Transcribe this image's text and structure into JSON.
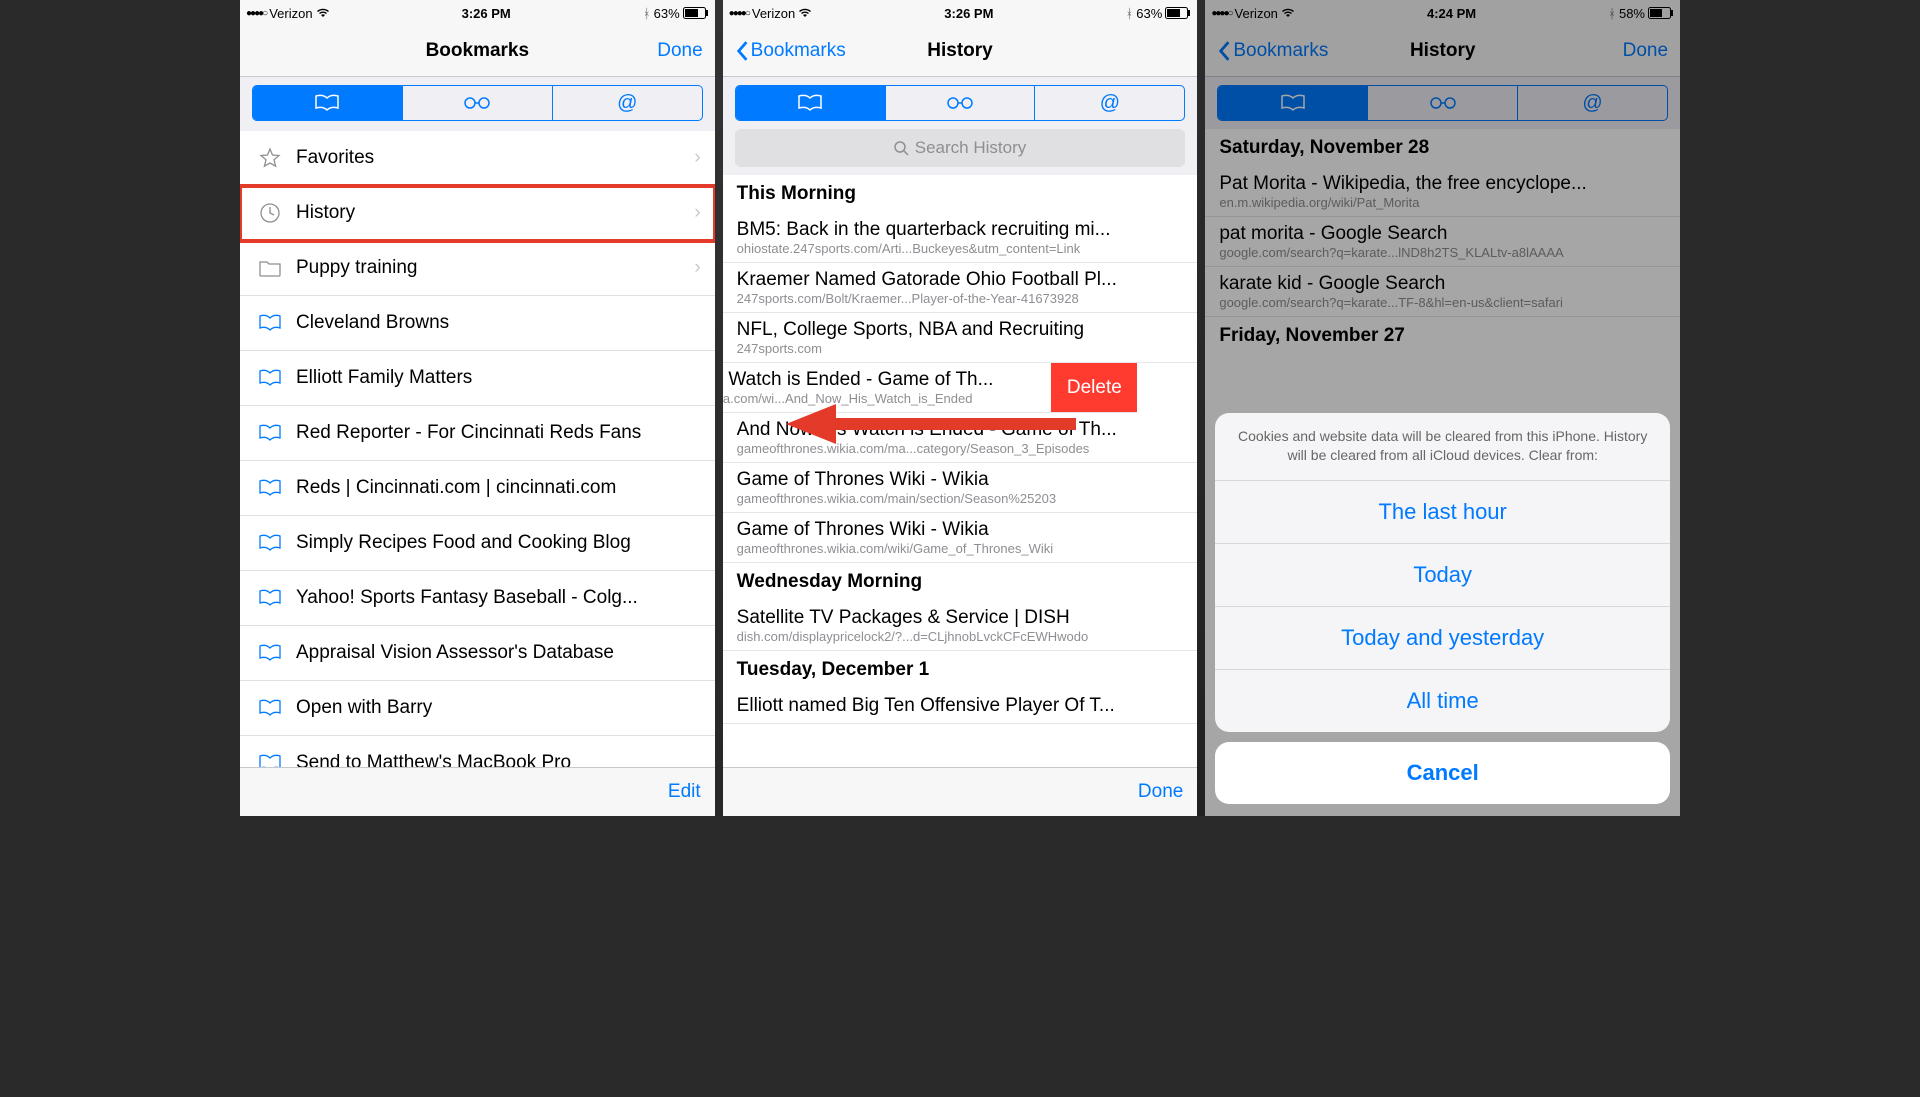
{
  "screen1": {
    "status": {
      "carrier": "Verizon",
      "time": "3:26 PM",
      "battery": "63%"
    },
    "nav": {
      "title": "Bookmarks",
      "done": "Done"
    },
    "rows": [
      {
        "label": "Favorites",
        "icon": "star",
        "chev": true
      },
      {
        "label": "History",
        "icon": "clock",
        "chev": true,
        "hl": true
      },
      {
        "label": "Puppy training",
        "icon": "folder",
        "chev": true
      },
      {
        "label": "Cleveland Browns",
        "icon": "book"
      },
      {
        "label": "Elliott Family Matters",
        "icon": "book"
      },
      {
        "label": "Red Reporter - For Cincinnati Reds Fans",
        "icon": "book"
      },
      {
        "label": "Reds | Cincinnati.com | cincinnati.com",
        "icon": "book"
      },
      {
        "label": "Simply Recipes Food and Cooking Blog",
        "icon": "book"
      },
      {
        "label": "Yahoo! Sports Fantasy Baseball - Colg...",
        "icon": "book"
      },
      {
        "label": "Appraisal Vision Assessor's Database",
        "icon": "book"
      },
      {
        "label": "Open with Barry",
        "icon": "book"
      },
      {
        "label": "Send to Matthew's MacBook Pro",
        "icon": "book"
      }
    ],
    "toolbar": {
      "edit": "Edit"
    }
  },
  "screen2": {
    "status": {
      "carrier": "Verizon",
      "time": "3:26 PM",
      "battery": "63%"
    },
    "nav": {
      "back": "Bookmarks",
      "title": "History"
    },
    "search_placeholder": "Search History",
    "groups": [
      {
        "header": "This Morning",
        "items": [
          {
            "t": "BM5: Back in the quarterback recruiting mi...",
            "u": "ohiostate.247sports.com/Arti...Buckeyes&utm_content=Link"
          },
          {
            "t": "Kraemer Named Gatorade Ohio Football Pl...",
            "u": "247sports.com/Bolt/Kraemer...Player-of-the-Year-41673928"
          },
          {
            "t": "NFL, College Sports, NBA and Recruiting",
            "u": "247sports.com"
          },
          {
            "t": "w His Watch is Ended - Game of Th...",
            "u": "nes.wikia.com/wi...And_Now_His_Watch_is_Ended",
            "swipe": true,
            "delete": "Delete"
          },
          {
            "t": "And Now His Watch is Ended - Game of Th...",
            "u": "gameofthrones.wikia.com/ma...category/Season_3_Episodes"
          },
          {
            "t": "Game of Thrones Wiki - Wikia",
            "u": "gameofthrones.wikia.com/main/section/Season%25203"
          },
          {
            "t": "Game of Thrones Wiki - Wikia",
            "u": "gameofthrones.wikia.com/wiki/Game_of_Thrones_Wiki"
          }
        ]
      },
      {
        "header": "Wednesday Morning",
        "items": [
          {
            "t": "Satellite TV Packages & Service | DISH",
            "u": "dish.com/displaypricelock2/?...d=CLjhnobLvckCFcEWHwodo"
          }
        ]
      },
      {
        "header": "Tuesday, December 1",
        "items": [
          {
            "t": "Elliott named Big Ten Offensive Player Of T...",
            "u": ""
          }
        ]
      }
    ],
    "toolbar": {
      "done": "Done"
    }
  },
  "screen3": {
    "status": {
      "carrier": "Verizon",
      "time": "4:24 PM",
      "battery": "58%"
    },
    "nav": {
      "back": "Bookmarks",
      "title": "History",
      "done": "Done"
    },
    "groups": [
      {
        "header": "Saturday, November 28",
        "items": [
          {
            "t": "Pat Morita - Wikipedia, the free encyclope...",
            "u": "en.m.wikipedia.org/wiki/Pat_Morita"
          },
          {
            "t": "pat morita - Google Search",
            "u": "google.com/search?q=karate...lND8h2TS_KLALtv-a8lAAAA"
          },
          {
            "t": "karate kid - Google Search",
            "u": "google.com/search?q=karate...TF-8&hl=en-us&client=safari"
          }
        ]
      },
      {
        "header": "Friday, November 27",
        "items": []
      }
    ],
    "sheet": {
      "message": "Cookies and website data will be cleared from this iPhone. History will be cleared from all iCloud devices. Clear from:",
      "options": [
        "The last hour",
        "Today",
        "Today and yesterday",
        "All time"
      ],
      "cancel": "Cancel"
    }
  }
}
